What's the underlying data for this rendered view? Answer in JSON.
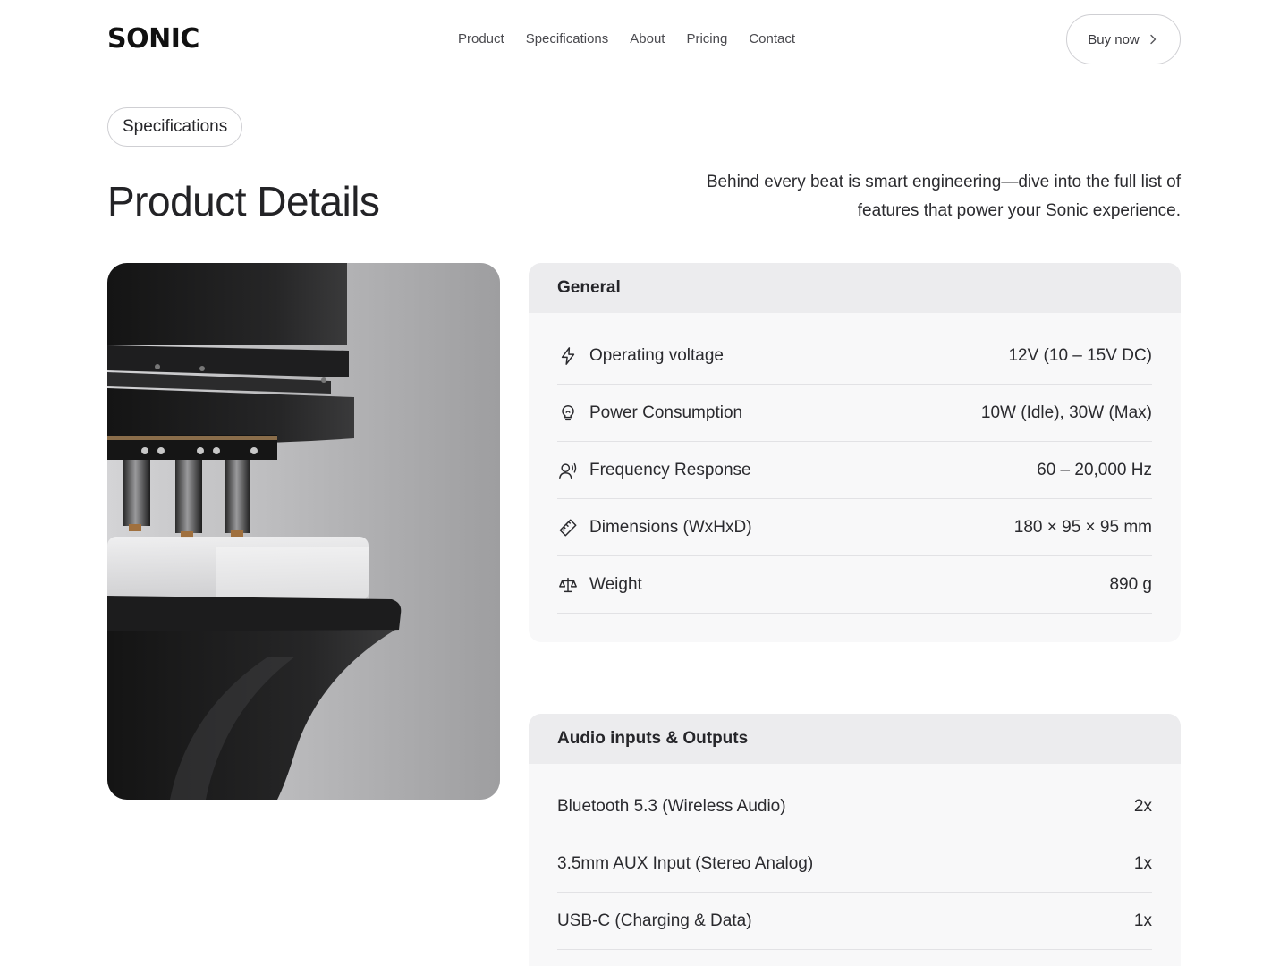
{
  "brand": {
    "logo": "SONIC"
  },
  "nav": {
    "items": [
      "Product",
      "Specifications",
      "About",
      "Pricing",
      "Contact"
    ]
  },
  "header": {
    "buy_label": "Buy now"
  },
  "intro": {
    "pill": "Specifications",
    "title": "Product Details",
    "lede": "Behind every beat is smart engineering—dive into the full list of features that power your Sonic experience."
  },
  "general": {
    "title": "General",
    "rows": [
      {
        "icon": "lightning-icon",
        "label": "Operating voltage",
        "value": "12V (10 – 15V DC)"
      },
      {
        "icon": "lightbulb-icon",
        "label": "Power Consumption",
        "value": "10W (Idle), 30W (Max)"
      },
      {
        "icon": "listening-icon",
        "label": "Frequency Response",
        "value": "60 – 20,000 Hz"
      },
      {
        "icon": "ruler-icon",
        "label": "Dimensions (WxHxD)",
        "value": "180 × 95 × 95 mm"
      },
      {
        "icon": "scale-icon",
        "label": "Weight",
        "value": "890 g"
      }
    ]
  },
  "audio": {
    "title": "Audio inputs & Outputs",
    "rows": [
      {
        "label": "Bluetooth 5.3 (Wireless Audio)",
        "value": "2x"
      },
      {
        "label": "3.5mm AUX Input (Stereo Analog)",
        "value": "1x"
      },
      {
        "label": "USB-C (Charging & Data)",
        "value": "1x"
      }
    ]
  }
}
